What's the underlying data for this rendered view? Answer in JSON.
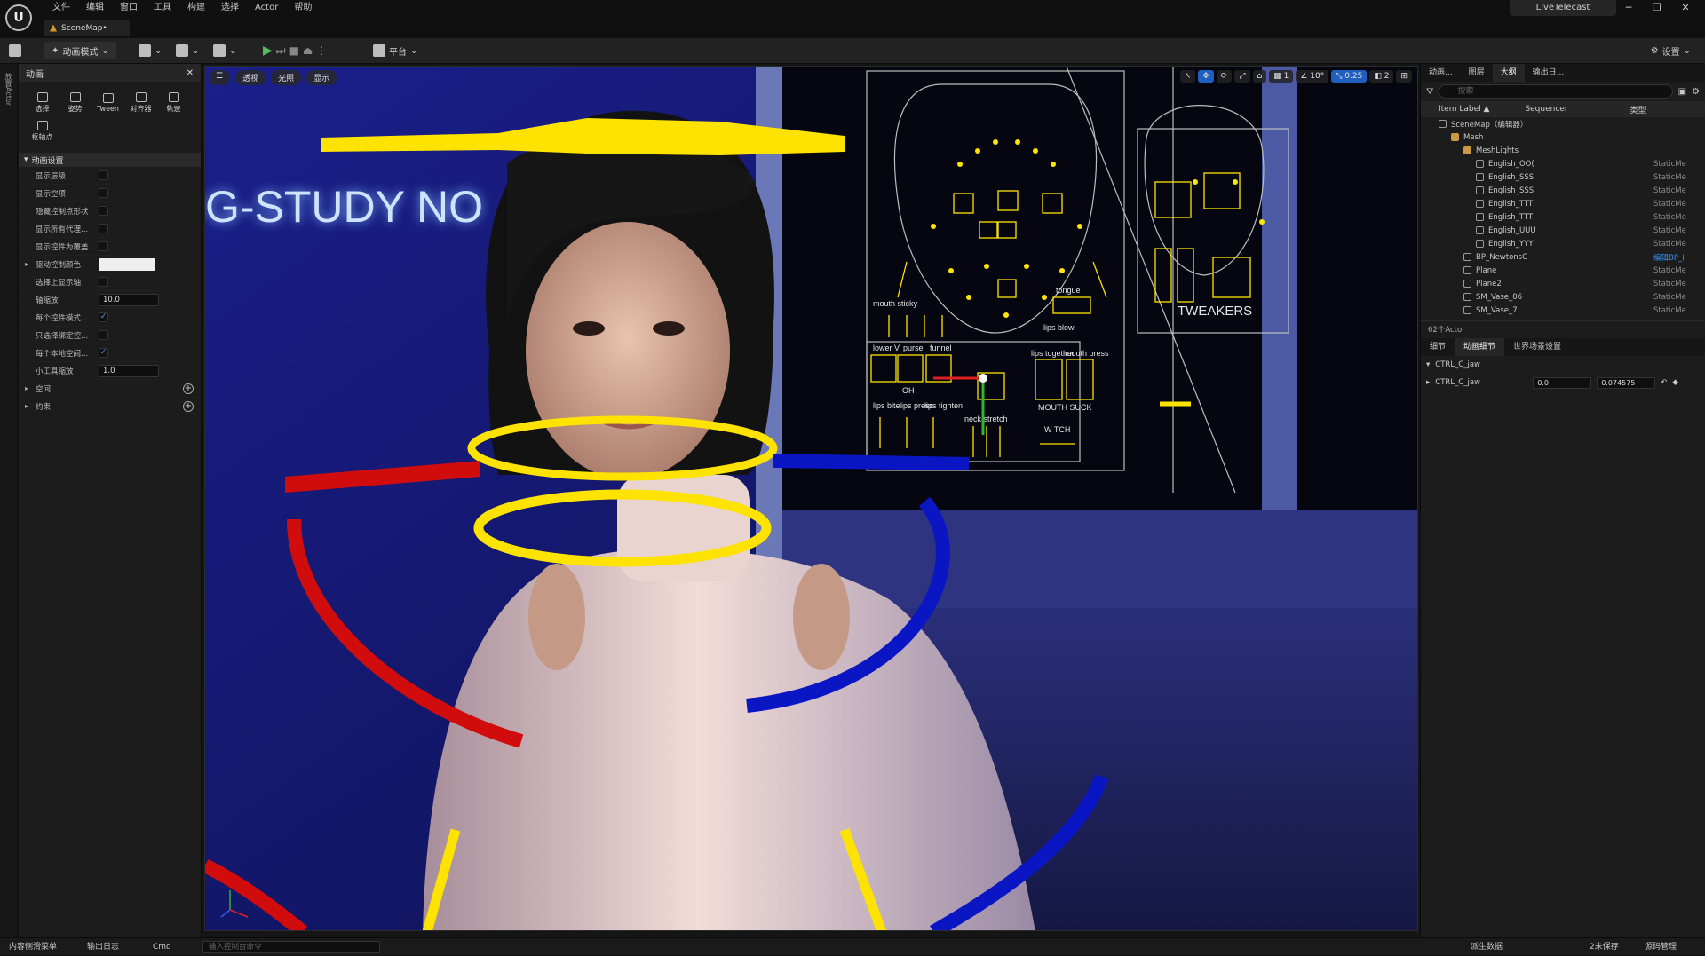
{
  "app": {
    "logo": "U",
    "menu": [
      "文件",
      "编辑",
      "窗口",
      "工具",
      "构建",
      "选择",
      "Actor",
      "帮助"
    ],
    "document_tab": "SceneMap•",
    "project_name": "LiveTelecast",
    "window_controls": [
      "─",
      "❐",
      "✕"
    ]
  },
  "toolbar": {
    "mode_label": "动画模式",
    "platform_label": "平台",
    "settings_label": "设置"
  },
  "left_strip": {
    "label": "放置Actor"
  },
  "left_panel": {
    "tab_title": "动画",
    "tools": [
      {
        "label": "选择",
        "icon": "select-icon"
      },
      {
        "label": "姿势",
        "icon": "pose-icon"
      },
      {
        "label": "Tween",
        "icon": "tween-icon"
      },
      {
        "label": "对齐器",
        "icon": "aligner-icon"
      },
      {
        "label": "轨迹",
        "icon": "trail-icon"
      },
      {
        "label": "枢轴点",
        "icon": "pivot-icon"
      }
    ],
    "section_title": "动画设置",
    "rows": [
      {
        "label": "显示层级",
        "kind": "checkbox",
        "checked": false
      },
      {
        "label": "显示空项",
        "kind": "checkbox",
        "checked": false
      },
      {
        "label": "隐藏控制点形状",
        "kind": "checkbox",
        "checked": false
      },
      {
        "label": "显示所有代理...",
        "kind": "checkbox",
        "checked": false
      },
      {
        "label": "显示控件为覆盖",
        "kind": "checkbox",
        "checked": false
      },
      {
        "label": "驱动控制颜色",
        "kind": "swatch",
        "color": "#efefef"
      },
      {
        "label": "选择上显示轴",
        "kind": "checkbox",
        "checked": false
      },
      {
        "label": "轴缩放",
        "kind": "number",
        "value": "10.0"
      },
      {
        "label": "每个控件模式...",
        "kind": "checkbox",
        "checked": true
      },
      {
        "label": "只选择绑定控...",
        "kind": "checkbox",
        "checked": false
      },
      {
        "label": "每个本地空间...",
        "kind": "checkbox",
        "checked": true
      },
      {
        "label": "小工具缩放",
        "kind": "number",
        "value": "1.0"
      }
    ],
    "collapsed_sections": [
      "空间",
      "约束"
    ]
  },
  "viewport": {
    "left_buttons": [
      "☰",
      "透视",
      "光照",
      "显示"
    ],
    "right_buttons": [
      {
        "label": "↖",
        "active": false
      },
      {
        "label": "✥",
        "active": true
      },
      {
        "label": "⟳",
        "active": false
      },
      {
        "label": "⤢",
        "active": false
      },
      {
        "label": "⌂",
        "active": false
      },
      {
        "label": "▦ 1",
        "active": false
      },
      {
        "label": "∠ 10°",
        "active": false
      },
      {
        "label": "⤡ 0.25",
        "active": true
      },
      {
        "label": "◧ 2",
        "active": false
      },
      {
        "label": "⊞",
        "active": false
      }
    ],
    "neon_text": "G-STUDY NO",
    "board_labels": {
      "mouth_sticky": "mouth sticky",
      "tongue": "tongue",
      "lips_blow": "lips blow",
      "lower_v": "lower V",
      "purse": "purse",
      "funnel": "funnel",
      "oh": "OH",
      "lips_bite": "lips bite",
      "lips_press": "lips press",
      "lips_tighten": "lips tighten",
      "lips_together": "lips together",
      "mouth_press": "mouth press",
      "mouth_suck": "MOUTH SUCK",
      "neck_stretch": "neck stretch",
      "w_tch": "W TCH",
      "tweakers": "TWEAKERS"
    }
  },
  "right_panel": {
    "top_tabs": [
      "动画...",
      "图层",
      "大纲",
      "输出日..."
    ],
    "search_placeholder": "搜索",
    "columns": {
      "label": "Item Label ▲",
      "sequencer": "Sequencer",
      "type": "类型"
    },
    "tree": [
      {
        "name": "SceneMap（编辑器）",
        "depth": 0,
        "type": "",
        "folder": false
      },
      {
        "name": "Mesh",
        "depth": 1,
        "type": "",
        "folder": true
      },
      {
        "name": "MeshLights",
        "depth": 2,
        "type": "",
        "folder": true
      },
      {
        "name": "English_OO(",
        "depth": 3,
        "type": "StaticMe",
        "folder": false
      },
      {
        "name": "English_SSS",
        "depth": 3,
        "type": "StaticMe",
        "folder": false
      },
      {
        "name": "English_SSS",
        "depth": 3,
        "type": "StaticMe",
        "folder": false
      },
      {
        "name": "English_TTT",
        "depth": 3,
        "type": "StaticMe",
        "folder": false
      },
      {
        "name": "English_TTT",
        "depth": 3,
        "type": "StaticMe",
        "folder": false
      },
      {
        "name": "English_UUU",
        "depth": 3,
        "type": "StaticMe",
        "folder": false
      },
      {
        "name": "English_YYY",
        "depth": 3,
        "type": "StaticMe",
        "folder": false
      },
      {
        "name": "BP_NewtonsC",
        "depth": 2,
        "type": "编辑BP_I",
        "folder": false,
        "link": true
      },
      {
        "name": "Plane",
        "depth": 2,
        "type": "StaticMe",
        "folder": false
      },
      {
        "name": "Plane2",
        "depth": 2,
        "type": "StaticMe",
        "folder": false
      },
      {
        "name": "SM_Vase_06",
        "depth": 2,
        "type": "StaticMe",
        "folder": false
      },
      {
        "name": "SM_Vase_7",
        "depth": 2,
        "type": "StaticMe",
        "folder": false
      }
    ],
    "actor_count": "62个Actor",
    "detail_tabs": [
      "细节",
      "动画细节",
      "世界场景设置"
    ],
    "detail_section": "CTRL_C_jaw",
    "detail_row": {
      "label": "CTRL_C_jaw",
      "x": "0.0",
      "y": "0.074575"
    }
  },
  "statusbar": {
    "content_drawer": "内容侧滑菜单",
    "output_log": "输出日志",
    "cmd": "Cmd",
    "cmd_placeholder": "输入控制台命令",
    "derived_data": "派生数据",
    "unsaved": "2未保存",
    "source_control": "源码管理"
  }
}
